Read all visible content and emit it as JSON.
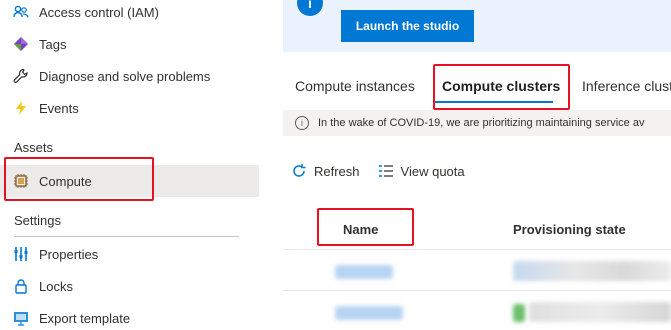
{
  "sidebar": {
    "items": [
      {
        "label": "Access control (IAM)",
        "icon": "people-icon"
      },
      {
        "label": "Tags",
        "icon": "tag-icon"
      },
      {
        "label": "Diagnose and solve problems",
        "icon": "wrench-icon"
      },
      {
        "label": "Events",
        "icon": "lightning-icon"
      }
    ],
    "assets_header": "Assets",
    "assets_items": [
      {
        "label": "Compute",
        "icon": "compute-chip-icon",
        "selected": true
      }
    ],
    "settings_header": "Settings",
    "settings_items": [
      {
        "label": "Properties",
        "icon": "properties-icon"
      },
      {
        "label": "Locks",
        "icon": "lock-icon"
      },
      {
        "label": "Export template",
        "icon": "export-template-icon"
      }
    ]
  },
  "banner": {
    "icon": "info-icon",
    "button_label": "Launch the studio"
  },
  "tabs": [
    {
      "label": "Compute instances",
      "active": false
    },
    {
      "label": "Compute clusters",
      "active": true
    },
    {
      "label": "Inference clust",
      "active": false
    }
  ],
  "notice": {
    "icon": "info-icon",
    "text": "In the wake of COVID-19, we are prioritizing maintaining service av"
  },
  "toolbar": {
    "refresh_label": "Refresh",
    "view_quota_label": "View quota"
  },
  "grid": {
    "columns": [
      "Name",
      "Provisioning state"
    ]
  },
  "colors": {
    "accent": "#0078d4",
    "highlight_box": "#e81123",
    "selected_bg": "#edebe9"
  }
}
